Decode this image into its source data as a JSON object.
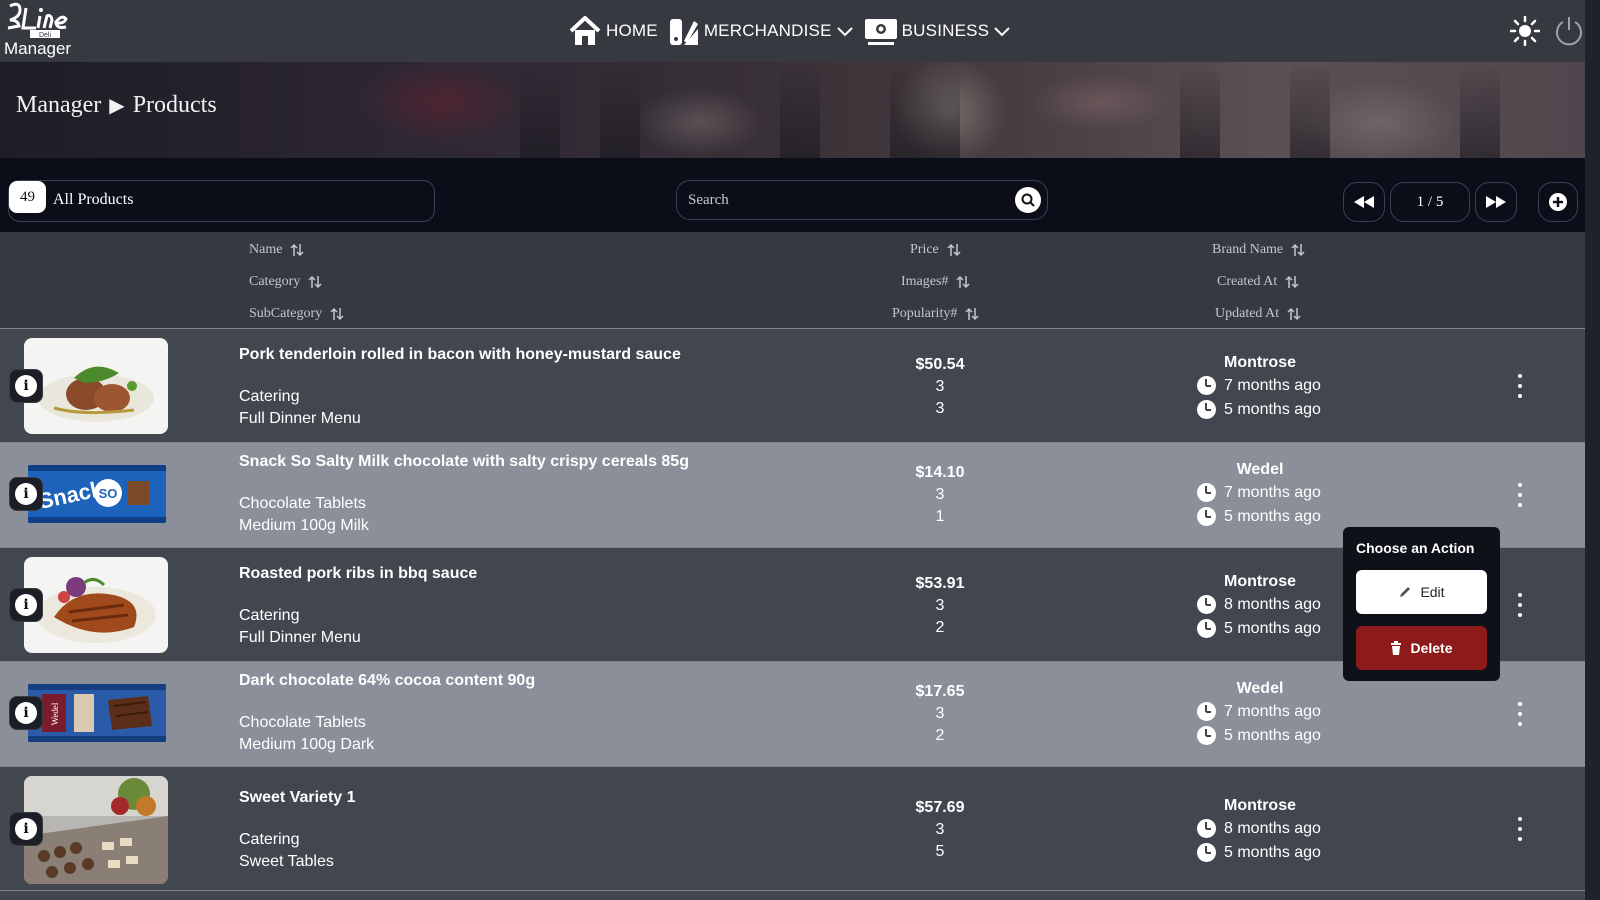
{
  "app": {
    "logo_text": "Line Deli",
    "logo_sub": "Manager"
  },
  "nav": {
    "items": [
      {
        "label": "HOME",
        "icon": "home-icon"
      },
      {
        "label": "MERCHANDISE",
        "icon": "merchandise-icon"
      },
      {
        "label": "BUSINESS",
        "icon": "business-icon"
      }
    ],
    "theme_icon": "sun-icon",
    "logout_icon": "power-icon"
  },
  "breadcrumb": {
    "root": "Manager",
    "separator": "▶",
    "current": "Products"
  },
  "toolbar": {
    "count": "49",
    "filter_label": "All Products",
    "search_placeholder": "Search",
    "page": "1 / 5"
  },
  "sort_headers": {
    "name": "Name",
    "category": "Category",
    "subcategory": "SubCategory",
    "price": "Price",
    "images": "Images#",
    "popularity": "Popularity#",
    "brand": "Brand Name",
    "created": "Created At",
    "updated": "Updated At"
  },
  "products": [
    {
      "name": "Pork tenderloin rolled in bacon with honey-mustard sauce",
      "category": "Catering",
      "subcategory": "Full Dinner Menu",
      "price": "$50.54",
      "images": "3",
      "popularity": "3",
      "brand": "Montrose",
      "created": "7 months ago",
      "updated": "5 months ago",
      "thumb": "plated-pork"
    },
    {
      "name": "Snack So Salty Milk chocolate with salty crispy cereals 85g",
      "category": "Chocolate Tablets",
      "subcategory": "Medium 100g Milk",
      "price": "$14.10",
      "images": "3",
      "popularity": "1",
      "brand": "Wedel",
      "created": "7 months ago",
      "updated": "5 months ago",
      "thumb": "choco-bar-snack"
    },
    {
      "name": "Roasted pork ribs in bbq sauce",
      "category": "Catering",
      "subcategory": "Full Dinner Menu",
      "price": "$53.91",
      "images": "3",
      "popularity": "2",
      "brand": "Montrose",
      "created": "8 months ago",
      "updated": "5 months ago",
      "thumb": "plated-ribs"
    },
    {
      "name": "Dark chocolate 64% cocoa content 90g",
      "category": "Chocolate Tablets",
      "subcategory": "Medium 100g Dark",
      "price": "$17.65",
      "images": "3",
      "popularity": "2",
      "brand": "Wedel",
      "created": "7 months ago",
      "updated": "5 months ago",
      "thumb": "choco-bar-dark"
    },
    {
      "name": "Sweet Variety 1",
      "category": "Catering",
      "subcategory": "Sweet Tables",
      "price": "$57.69",
      "images": "3",
      "popularity": "5",
      "brand": "Montrose",
      "created": "8 months ago",
      "updated": "5 months ago",
      "thumb": "sweet-table"
    }
  ],
  "action_menu": {
    "title": "Choose an Action",
    "edit_label": "Edit",
    "delete_label": "Delete"
  },
  "colors": {
    "topbar": "#363a40",
    "row_dark": "#42474f",
    "row_light": "#8a8f99",
    "toolbar": "#0b0e19",
    "delete": "#8d1b1b"
  }
}
